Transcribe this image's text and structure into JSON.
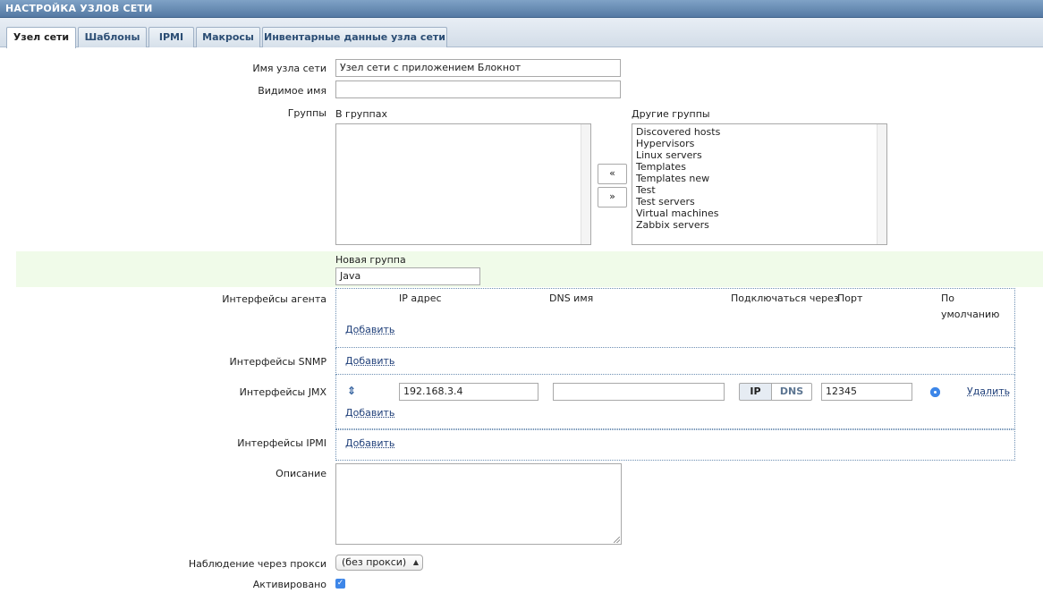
{
  "header": {
    "title": "НАСТРОЙКА УЗЛОВ СЕТИ"
  },
  "tabs": [
    {
      "label": "Узел сети"
    },
    {
      "label": "Шаблоны"
    },
    {
      "label": "IPMI"
    },
    {
      "label": "Макросы"
    },
    {
      "label": "Инвентарные данные узла сети"
    }
  ],
  "form": {
    "host_name_label": "Имя узла сети",
    "host_name_value": "Узел сети с приложением Блокнот",
    "visible_name_label": "Видимое имя",
    "visible_name_value": "",
    "groups_label": "Группы",
    "in_groups_label": "В группах",
    "other_groups_label": "Другие группы",
    "other_groups": [
      "Discovered hosts",
      "Hypervisors",
      "Linux servers",
      "Templates",
      "Templates new",
      "Test",
      "Test servers",
      "Virtual machines",
      "Zabbix servers"
    ],
    "move_left_label": "«",
    "move_right_label": "»",
    "new_group_label": "Новая группа",
    "new_group_value": "Java",
    "agent_interfaces_label": "Интерфейсы агента",
    "col_ip": "IP адрес",
    "col_dns": "DNS имя",
    "col_connect": "Подключаться через",
    "col_port": "Порт",
    "col_default_1": "По",
    "col_default_2": "умолчанию",
    "add_label": "Добавить",
    "snmp_interfaces_label": "Интерфейсы SNMP",
    "jmx_interfaces_label": "Интерфейсы JMX",
    "jmx": {
      "ip": "192.168.3.4",
      "dns": "",
      "connect_ip": "IP",
      "connect_dns": "DNS",
      "port": "12345",
      "remove_label": "Удалить"
    },
    "ipmi_interfaces_label": "Интерфейсы IPMI",
    "description_label": "Описание",
    "description_value": "",
    "proxy_label": "Наблюдение через прокси",
    "proxy_value": "(без прокси)",
    "enabled_label": "Активировано",
    "enabled": true
  },
  "colors": {
    "header": "#5e83ad",
    "link": "#1f3f79",
    "highlight_band": "#f0fbe9",
    "accent": "#3d86e8"
  }
}
